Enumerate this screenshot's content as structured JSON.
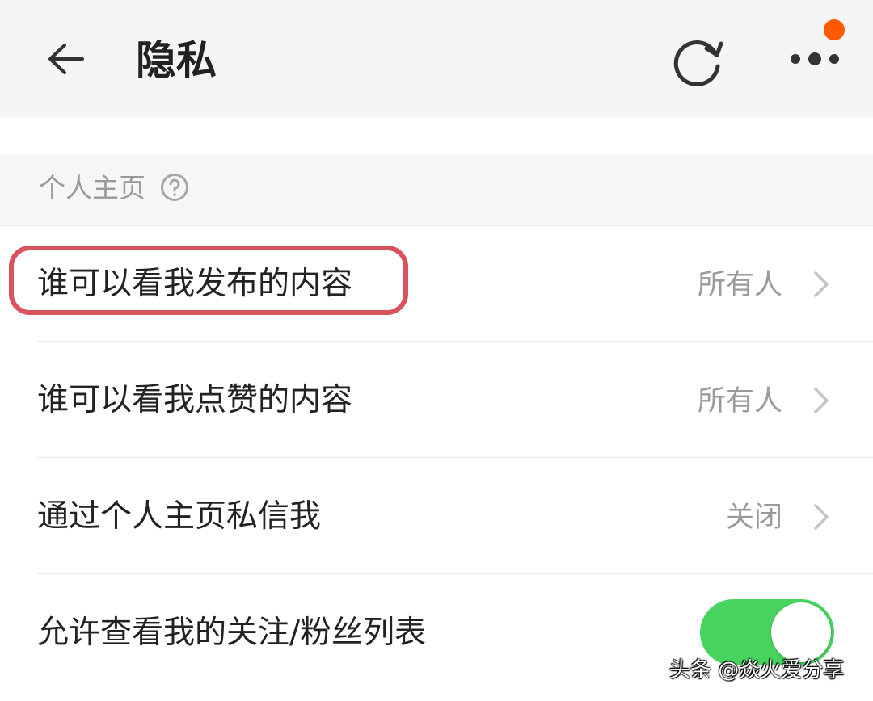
{
  "header": {
    "title": "隐私",
    "back_icon": "back-arrow-icon",
    "refresh_icon": "refresh-icon",
    "more_icon": "more-dots-icon",
    "notify_dot_color": "#ff5a00"
  },
  "section": {
    "title": "个人主页",
    "help_icon": "help-icon"
  },
  "rows": [
    {
      "label": "谁可以看我发布的内容",
      "value": "所有人",
      "highlighted": true
    },
    {
      "label": "谁可以看我点赞的内容",
      "value": "所有人"
    },
    {
      "label": "通过个人主页私信我",
      "value": "关闭"
    },
    {
      "label": "允许查看我的关注/粉丝列表",
      "toggle_on": true
    }
  ],
  "colors": {
    "toggle_on": "#48d35f",
    "highlight": "#d9535c"
  },
  "watermark": "头条 @焱火爱分享"
}
